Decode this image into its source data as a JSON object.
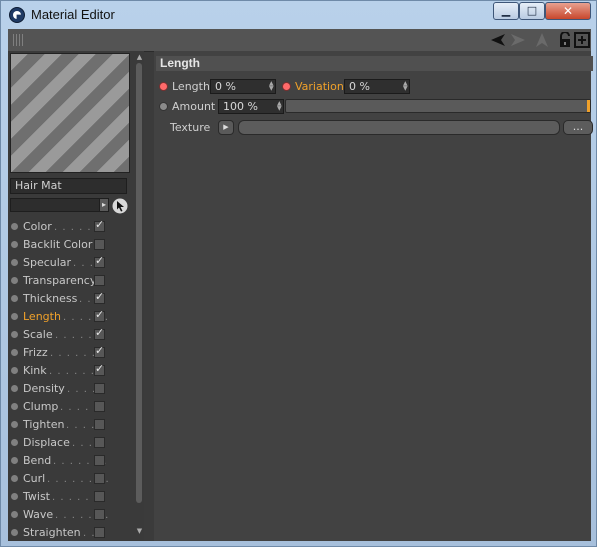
{
  "window": {
    "title": "Material Editor",
    "min_label": "▁",
    "max_label": "□",
    "close_label": "✕"
  },
  "preview": {
    "material_name": "Hair Mat"
  },
  "channels": [
    {
      "label": "Color",
      "leader": ". . . . . .",
      "checked": true
    },
    {
      "label": "Backlit Color",
      "leader": "",
      "checked": false
    },
    {
      "label": "Specular",
      "leader": ". . . .",
      "checked": true
    },
    {
      "label": "Transparency",
      "leader": "",
      "checked": false
    },
    {
      "label": "Thickness",
      "leader": ". . .",
      "checked": true
    },
    {
      "label": "Length",
      "leader": ". . . . . .",
      "checked": true,
      "active": true
    },
    {
      "label": "Scale",
      "leader": ". . . . . .",
      "checked": true
    },
    {
      "label": "Frizz",
      "leader": ". . . . . . .",
      "checked": true
    },
    {
      "label": "Kink",
      "leader": ". . . . . . .",
      "checked": true
    },
    {
      "label": "Density",
      "leader": ". . . . .",
      "checked": false
    },
    {
      "label": "Clump",
      "leader": ". . . . . .",
      "checked": false
    },
    {
      "label": "Tighten",
      "leader": ". . . . .",
      "checked": false
    },
    {
      "label": "Displace",
      "leader": ". . . .",
      "checked": false
    },
    {
      "label": "Bend",
      "leader": ". . . . . . .",
      "checked": false
    },
    {
      "label": "Curl",
      "leader": ". . . . . . . .",
      "checked": false
    },
    {
      "label": "Twist",
      "leader": ". . . . . . .",
      "checked": false
    },
    {
      "label": "Wave",
      "leader": ". . . . . . .",
      "checked": false
    },
    {
      "label": "Straighten",
      "leader": ". .",
      "checked": false
    }
  ],
  "check_glyph": "✓",
  "section": {
    "title": "Length"
  },
  "params": {
    "length_label": "Length",
    "length_value": "0 %",
    "variation_label": "Variation",
    "variation_value": "0 %",
    "amount_label": "Amount",
    "amount_value": "100 %",
    "amount_fraction": 1.0,
    "texture_label": "Texture",
    "texture_more_label": "..."
  },
  "colors": {
    "accent": "#f0a12a",
    "keyframe_dot": "#ff6a6a"
  },
  "icons": {
    "back": "arrow-back-icon",
    "forward": "arrow-forward-icon",
    "up": "arrow-up-icon",
    "lock": "lock-icon",
    "new_window": "new-window-icon",
    "picker": "pointer-picker-icon"
  }
}
